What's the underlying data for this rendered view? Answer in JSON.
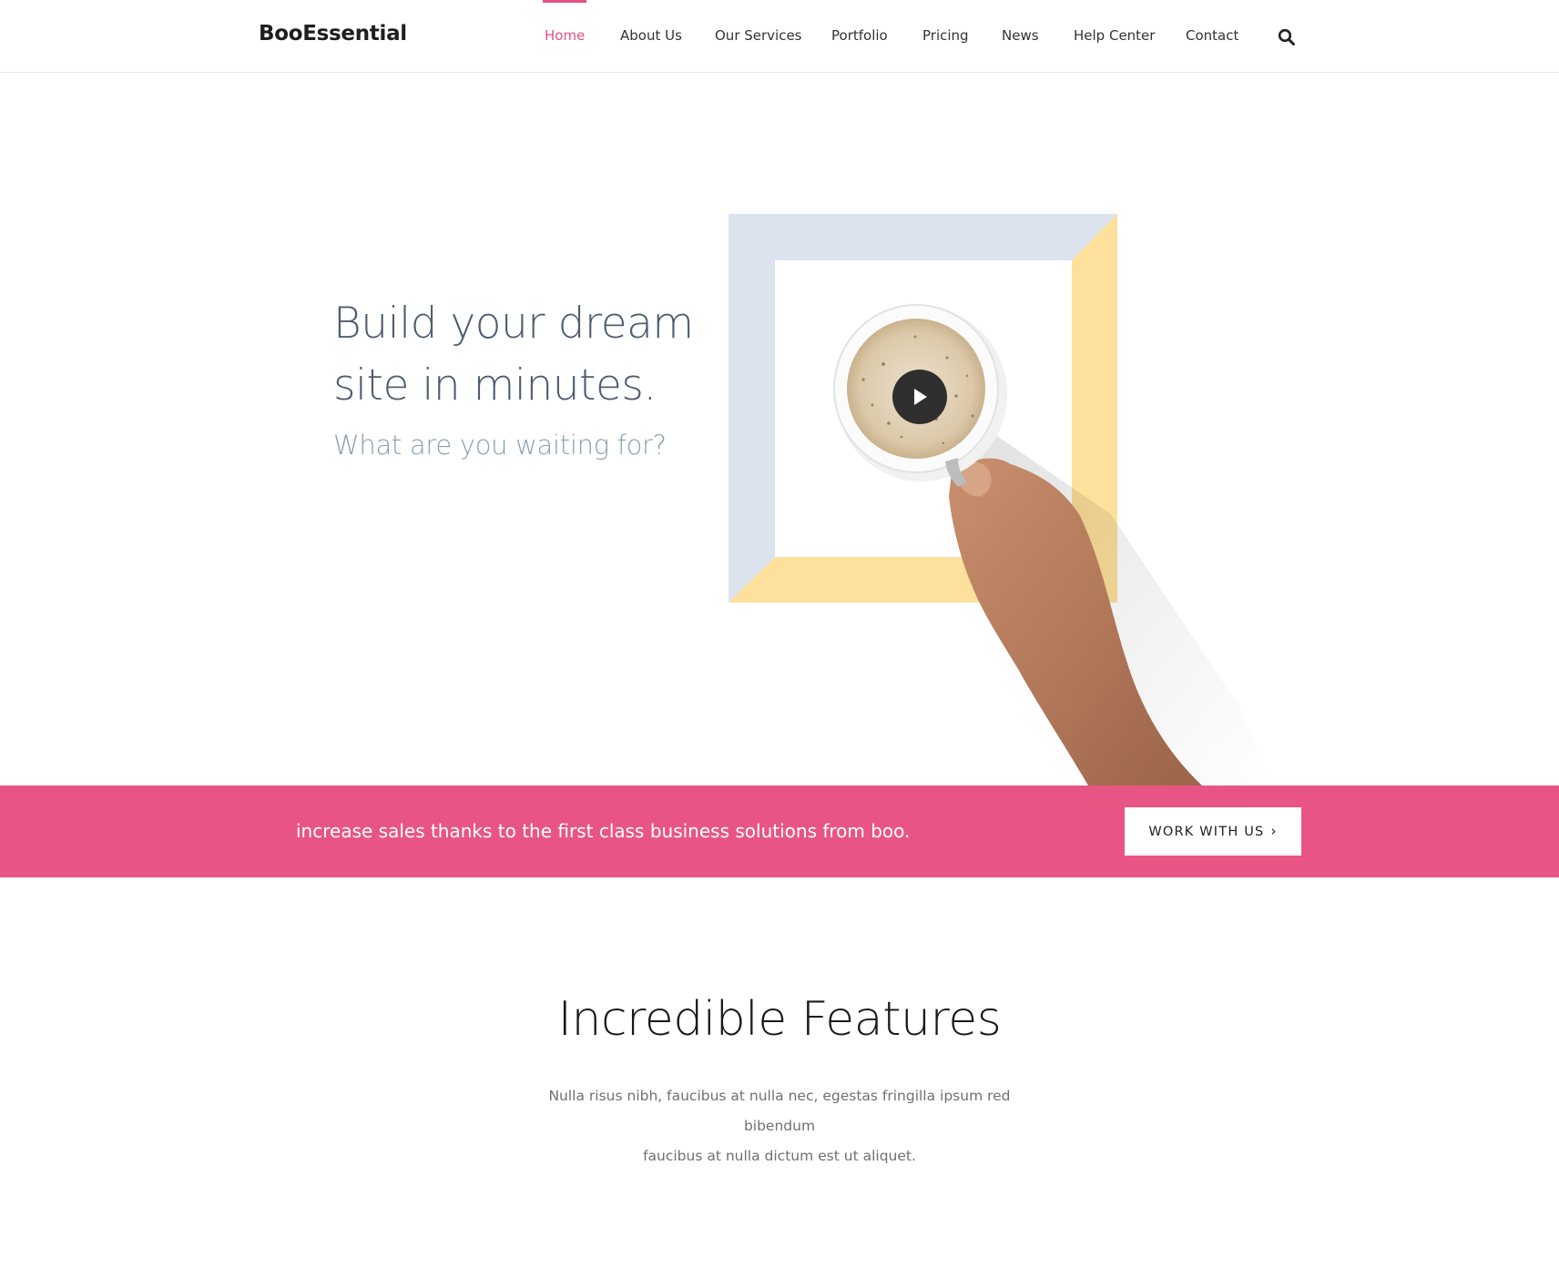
{
  "header": {
    "logo": "BooEssential",
    "nav": [
      {
        "label": "Home",
        "active": true
      },
      {
        "label": "About Us",
        "active": false
      },
      {
        "label": "Our Services",
        "active": false
      },
      {
        "label": "Portfolio",
        "active": false
      },
      {
        "label": "Pricing",
        "active": false
      },
      {
        "label": "News",
        "active": false
      },
      {
        "label": "Help Center",
        "active": false
      },
      {
        "label": "Contact",
        "active": false
      }
    ],
    "search_icon": "search-icon"
  },
  "hero": {
    "title_line1": "Build your dream",
    "title_line2": "site in minutes.",
    "subtitle": "What are you waiting for?",
    "play_icon": "play-icon"
  },
  "banner": {
    "text": "increase sales thanks to the first class business solutions from boo.",
    "cta_label": "WORK WITH US",
    "cta_icon": "chevron-right-icon",
    "cta_glyph": "›"
  },
  "features": {
    "title": "Incredible Features",
    "desc_line1": "Nulla risus nibh, faucibus at nulla nec, egestas fringilla ipsum red bibendum",
    "desc_line2": "faucibus at nulla dictum est ut aliquet."
  },
  "colors": {
    "accent": "#e25086",
    "banner": "#e85584",
    "frame_blue": "#dde2ef",
    "frame_yellow": "#fde09b"
  }
}
